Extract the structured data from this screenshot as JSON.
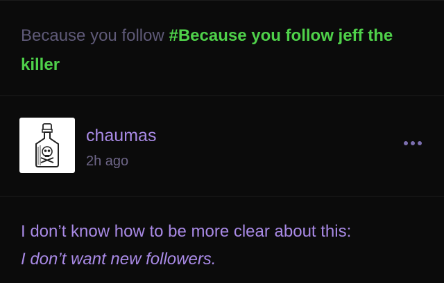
{
  "recommendation": {
    "prefix": "Because you follow",
    "tag": "#Because you follow jeff the killer"
  },
  "post": {
    "username": "chaumas",
    "time": "2h ago",
    "avatar_icon": "poison-bottle-skull-icon",
    "more_icon": "more-dots-icon",
    "body_line1": "I don’t know how to be more clear about this:",
    "body_line2": "I don’t want new followers."
  },
  "colors": {
    "background": "#0b0b0b",
    "accent_purple": "#a98ae6",
    "tag_green": "#4fd14a",
    "muted": "#5f5a78"
  }
}
